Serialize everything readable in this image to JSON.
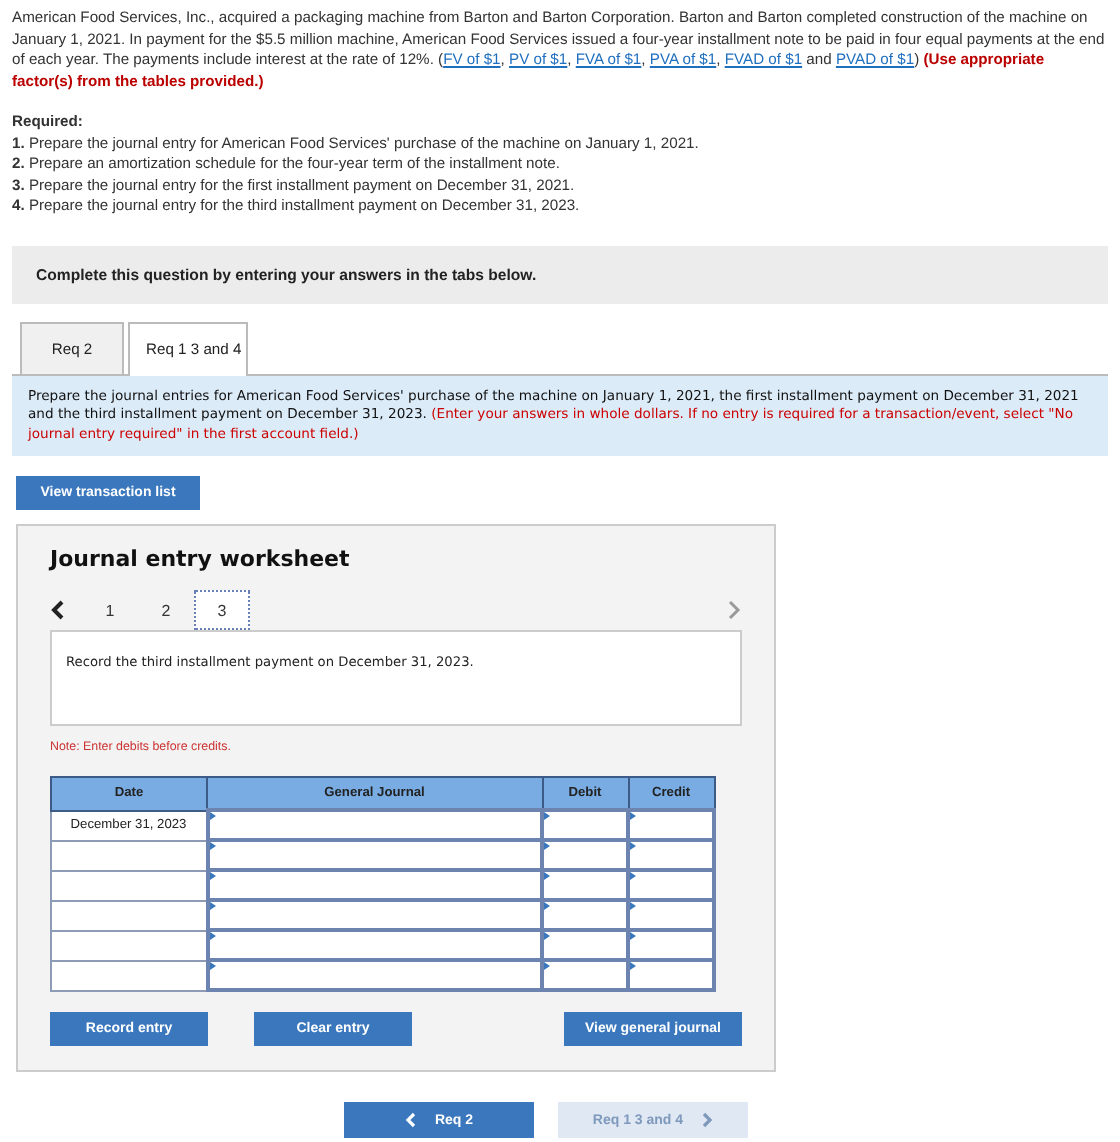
{
  "intro": [
    {
      "kind": "text",
      "text": "American Food Services, Inc., acquired a packaging machine from Barton and Barton Corporation. Barton and Barton completed construction of the machine on January 1, 2021. In payment for the $5.5 million machine, American Food Services issued a four-year installment note to be paid in four equal payments at the end of each year. The payments include interest at the rate of 12%. ("
    },
    {
      "kind": "link",
      "text": "FV of $1"
    },
    {
      "kind": "text",
      "text": ", "
    },
    {
      "kind": "link",
      "text": "PV of $1"
    },
    {
      "kind": "text",
      "text": ", "
    },
    {
      "kind": "link",
      "text": "FVA of $1"
    },
    {
      "kind": "text",
      "text": ", "
    },
    {
      "kind": "link",
      "text": "PVA of $1"
    },
    {
      "kind": "text",
      "text": ", "
    },
    {
      "kind": "link",
      "text": "FVAD of $1"
    },
    {
      "kind": "text",
      "text": " and "
    },
    {
      "kind": "link",
      "text": "PVAD of $1"
    },
    {
      "kind": "text",
      "text": ")"
    },
    {
      "kind": "alert",
      "text": " (Use appropriate factor(s) from the tables provided.)"
    }
  ],
  "required": {
    "title": "Required:",
    "items": [
      "**1.** Prepare the journal entry for American Food Services' purchase of the machine on January 1, 2021.",
      "**2.** Prepare an amortization schedule for the four-year term of the installment note.",
      "**3.** Prepare the journal entry for the first installment payment on December 31, 2021.",
      "**4.** Prepare the journal entry for the third installment payment on December 31, 2023."
    ]
  },
  "banner": "Complete this question by entering your answers in the tabs below.",
  "tabs": [
    {
      "label": "Req 2",
      "selected": false
    },
    {
      "label": "Req 1 3 and 4",
      "selected": true
    }
  ],
  "instructions": {
    "text": "Prepare the journal entries for American Food Services' purchase of the machine on January 1, 2021, the first installment payment on December 31, 2021 and the third installment payment on December 31, 2023.",
    "alert": "(Enter your answers in whole dollars. If no entry is required for a transaction/event, select \"No journal entry required\" in the first account field.)"
  },
  "transaction_button": "View transaction list",
  "worksheet": {
    "title": "Journal entry worksheet",
    "pages": [
      {
        "label": "1",
        "selected": false
      },
      {
        "label": "2",
        "selected": false
      },
      {
        "label": "3",
        "selected": true
      }
    ],
    "prompt": "Record the third installment payment on December 31, 2023.",
    "note": "Note: Enter debits before credits.",
    "columns": [
      "Date",
      "General Journal",
      "Debit",
      "Credit"
    ],
    "rows": [
      {
        "date": "December 31, 2023"
      },
      {},
      {},
      {},
      {},
      {}
    ],
    "buttons": [
      "Record entry",
      "Clear entry",
      "View general journal"
    ]
  },
  "nav": [
    {
      "label": "Req 2",
      "kind": "prev",
      "disabled": false
    },
    {
      "label": "Req 1 3 and 4",
      "kind": "next",
      "disabled": true
    }
  ]
}
